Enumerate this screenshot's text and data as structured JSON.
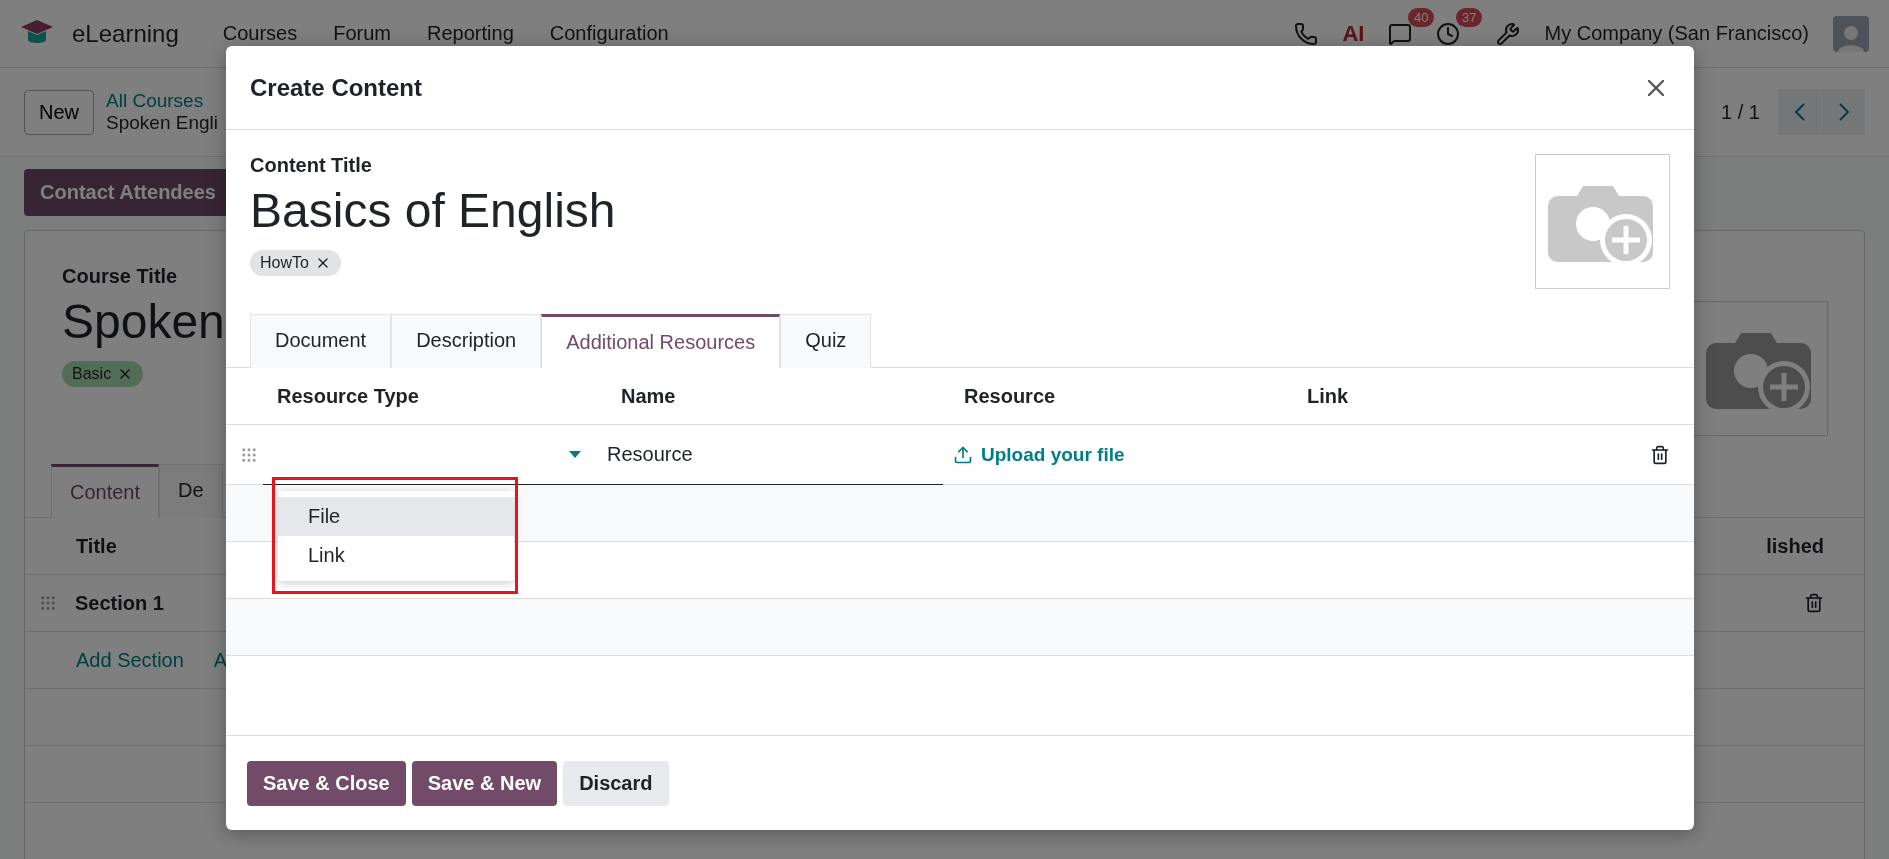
{
  "navbar": {
    "app": "eLearning",
    "menu": [
      "Courses",
      "Forum",
      "Reporting",
      "Configuration"
    ],
    "ai_label": "AI",
    "messages_badge": "40",
    "activities_badge": "37",
    "company": "My Company (San Francisco)"
  },
  "control_panel": {
    "new_button": "New",
    "breadcrumb": "All Courses",
    "record": "Spoken Engli",
    "pager": "1 / 1"
  },
  "form": {
    "action": "Contact Attendees",
    "title_label": "Course Title",
    "title": "Spoken",
    "tags": [
      "Basic"
    ],
    "tabs": [
      {
        "label": "Content",
        "selected": true
      },
      {
        "label": "De",
        "selected": false
      }
    ],
    "columns": [
      "Title",
      "lished"
    ],
    "rows": [
      {
        "title": "Section 1"
      }
    ],
    "add_links": [
      "Add Section",
      "A"
    ]
  },
  "dialog": {
    "title": "Create Content",
    "field_label": "Content Title",
    "content_title": "Basics of English",
    "tags": [
      "HowTo"
    ],
    "tabs": [
      {
        "label": "Document",
        "selected": false
      },
      {
        "label": "Description",
        "selected": false
      },
      {
        "label": "Additional Resources",
        "selected": true
      },
      {
        "label": "Quiz",
        "selected": false
      }
    ],
    "columns": [
      "Resource Type",
      "Name",
      "Resource",
      "Link"
    ],
    "rows": [
      {
        "name": "Resource",
        "upload": "Upload your file"
      }
    ],
    "dropdown": [
      {
        "label": "File",
        "highlighted": true
      },
      {
        "label": "Link",
        "highlighted": false
      }
    ],
    "buttons": [
      {
        "label": "Save & Close",
        "kind": "primary"
      },
      {
        "label": "Save & New",
        "kind": "primary"
      },
      {
        "label": "Discard",
        "kind": "secondary"
      }
    ]
  }
}
